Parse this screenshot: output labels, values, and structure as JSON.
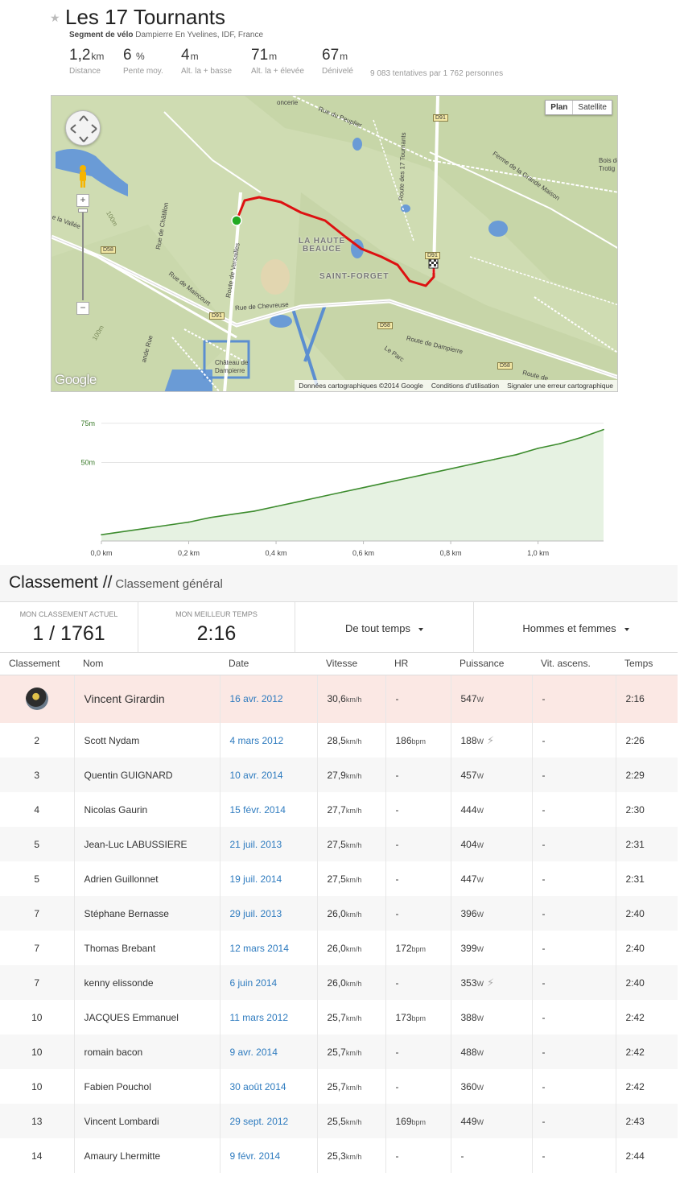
{
  "segment": {
    "title": "Les 17 Tournants",
    "subtitle_label": "Segment de vélo",
    "subtitle_location": "Dampierre En Yvelines, IDF, France",
    "stats": [
      {
        "value": "1,2",
        "unit": "km",
        "label": "Distance"
      },
      {
        "value": "6",
        "unit": "%",
        "label": "Pente moy."
      },
      {
        "value": "4",
        "unit": "m",
        "label": "Alt. la + basse"
      },
      {
        "value": "71",
        "unit": "m",
        "label": "Alt. la + élevée"
      },
      {
        "value": "67",
        "unit": "m",
        "label": "Dénivelé"
      }
    ],
    "attempts": "9 083 tentatives par 1 762 personnes"
  },
  "map": {
    "type_plan": "Plan",
    "type_satellite": "Satellite",
    "logo": "Google",
    "footer": [
      "Données cartographiques ©2014 Google",
      "Conditions d'utilisation",
      "Signaler une erreur cartographique"
    ],
    "labels": {
      "rue_peuplier": "Rue du Peuplier",
      "route_17": "Route des 17 Tournants",
      "ferme": "Ferme de la Grande Maison",
      "bois": "Bois de",
      "trotigny": "Trotig",
      "la_haute": "LA HAUTE",
      "beauce": "BEAUCE",
      "saint_forget": "SAINT-FORGET",
      "rue_chatillon": "Rue de Châtillon",
      "route_versailles": "Route de Versailles",
      "rue_maincourt": "Rue de Maincourt",
      "rue_chevreuse": "Rue de Chevreuse",
      "route_dampierre": "Route de Dampierre",
      "le_parc": "Le Parc",
      "route_de": "Route de",
      "chateau": "Château de",
      "dampierre": "Dampierre",
      "la_vallee": "e la Vallée",
      "conciere": "oncerie",
      "elev_100a": "100m",
      "elev_100b": "100m",
      "grande_rue": "ande Rue"
    },
    "shields": {
      "d91_a": "D91",
      "d91_b": "D91",
      "d91_c": "D91",
      "d58_a": "D58",
      "d58_b": "D58",
      "d58_c": "D58"
    },
    "route_color": "#dd1111",
    "start_marker_color": "#22aa22"
  },
  "chart_data": {
    "type": "area",
    "title": "",
    "xlabel": "",
    "ylabel": "",
    "x": [
      0.0,
      0.05,
      0.1,
      0.15,
      0.2,
      0.25,
      0.3,
      0.35,
      0.4,
      0.45,
      0.5,
      0.55,
      0.6,
      0.65,
      0.7,
      0.75,
      0.8,
      0.85,
      0.9,
      0.95,
      1.0,
      1.05,
      1.1,
      1.15
    ],
    "y": [
      4,
      6,
      8,
      10,
      12,
      15,
      17,
      19,
      22,
      25,
      28,
      31,
      34,
      37,
      40,
      43,
      46,
      49,
      52,
      55,
      59,
      62,
      66,
      71
    ],
    "xlim": [
      0,
      1.15
    ],
    "ylim": [
      0,
      80
    ],
    "xticks": [
      "0,0 km",
      "0,2 km",
      "0,4 km",
      "0,6 km",
      "0,8 km",
      "1,0 km"
    ],
    "xtick_values": [
      0,
      0.2,
      0.4,
      0.6,
      0.8,
      1.0
    ],
    "yticks": [
      "50m",
      "75m"
    ],
    "ytick_values": [
      50,
      75
    ],
    "line_color": "#3d8c2e",
    "fill_color": "#e6f2e2"
  },
  "leaderboard": {
    "title": "Classement",
    "separator": "//",
    "subtitle": "Classement général",
    "my_rank_label": "Mon classement actuel",
    "my_rank": "1 / 1761",
    "my_best_label": "Mon meilleur temps",
    "my_best": "2:16",
    "filter_time": "De tout temps",
    "filter_gender": "Hommes et femmes",
    "columns": [
      "Classement",
      "Nom",
      "Date",
      "Vitesse",
      "HR",
      "Puissance",
      "Vit. ascens.",
      "Temps"
    ],
    "rows": [
      {
        "rank": "",
        "name": "Vincent Girardin",
        "date": "16 avr. 2012",
        "speed": "30,6",
        "speed_unit": "km/h",
        "hr": "-",
        "hr_unit": "",
        "power": "547",
        "power_unit": "W",
        "bolt": false,
        "vam": "-",
        "time": "2:16",
        "me": true
      },
      {
        "rank": "2",
        "name": "Scott Nydam",
        "date": "4 mars 2012",
        "speed": "28,5",
        "speed_unit": "km/h",
        "hr": "186",
        "hr_unit": "bpm",
        "power": "188",
        "power_unit": "W",
        "bolt": true,
        "vam": "-",
        "time": "2:26"
      },
      {
        "rank": "3",
        "name": "Quentin GUIGNARD",
        "date": "10 avr. 2014",
        "speed": "27,9",
        "speed_unit": "km/h",
        "hr": "-",
        "hr_unit": "",
        "power": "457",
        "power_unit": "W",
        "bolt": false,
        "vam": "-",
        "time": "2:29"
      },
      {
        "rank": "4",
        "name": "Nicolas Gaurin",
        "date": "15 févr. 2014",
        "speed": "27,7",
        "speed_unit": "km/h",
        "hr": "-",
        "hr_unit": "",
        "power": "444",
        "power_unit": "W",
        "bolt": false,
        "vam": "-",
        "time": "2:30"
      },
      {
        "rank": "5",
        "name": "Jean-Luc LABUSSIERE",
        "date": "21 juil. 2013",
        "speed": "27,5",
        "speed_unit": "km/h",
        "hr": "-",
        "hr_unit": "",
        "power": "404",
        "power_unit": "W",
        "bolt": false,
        "vam": "-",
        "time": "2:31"
      },
      {
        "rank": "5",
        "name": "Adrien Guillonnet",
        "date": "19 juil. 2014",
        "speed": "27,5",
        "speed_unit": "km/h",
        "hr": "-",
        "hr_unit": "",
        "power": "447",
        "power_unit": "W",
        "bolt": false,
        "vam": "-",
        "time": "2:31"
      },
      {
        "rank": "7",
        "name": "Stéphane Bernasse",
        "date": "29 juil. 2013",
        "speed": "26,0",
        "speed_unit": "km/h",
        "hr": "-",
        "hr_unit": "",
        "power": "396",
        "power_unit": "W",
        "bolt": false,
        "vam": "-",
        "time": "2:40"
      },
      {
        "rank": "7",
        "name": "Thomas Brebant",
        "date": "12 mars 2014",
        "speed": "26,0",
        "speed_unit": "km/h",
        "hr": "172",
        "hr_unit": "bpm",
        "power": "399",
        "power_unit": "W",
        "bolt": false,
        "vam": "-",
        "time": "2:40"
      },
      {
        "rank": "7",
        "name": "kenny elissonde",
        "date": "6 juin 2014",
        "speed": "26,0",
        "speed_unit": "km/h",
        "hr": "-",
        "hr_unit": "",
        "power": "353",
        "power_unit": "W",
        "bolt": true,
        "vam": "-",
        "time": "2:40"
      },
      {
        "rank": "10",
        "name": "JACQUES Emmanuel",
        "date": "11 mars 2012",
        "speed": "25,7",
        "speed_unit": "km/h",
        "hr": "173",
        "hr_unit": "bpm",
        "power": "388",
        "power_unit": "W",
        "bolt": false,
        "vam": "-",
        "time": "2:42"
      },
      {
        "rank": "10",
        "name": "romain bacon",
        "date": "9 avr. 2014",
        "speed": "25,7",
        "speed_unit": "km/h",
        "hr": "-",
        "hr_unit": "",
        "power": "488",
        "power_unit": "W",
        "bolt": false,
        "vam": "-",
        "time": "2:42"
      },
      {
        "rank": "10",
        "name": "Fabien Pouchol",
        "date": "30 août 2014",
        "speed": "25,7",
        "speed_unit": "km/h",
        "hr": "-",
        "hr_unit": "",
        "power": "360",
        "power_unit": "W",
        "bolt": false,
        "vam": "-",
        "time": "2:42"
      },
      {
        "rank": "13",
        "name": "Vincent Lombardi",
        "date": "29 sept. 2012",
        "speed": "25,5",
        "speed_unit": "km/h",
        "hr": "169",
        "hr_unit": "bpm",
        "power": "449",
        "power_unit": "W",
        "bolt": false,
        "vam": "-",
        "time": "2:43"
      },
      {
        "rank": "14",
        "name": "Amaury Lhermitte",
        "date": "9 févr. 2014",
        "speed": "25,3",
        "speed_unit": "km/h",
        "hr": "-",
        "hr_unit": "",
        "power": "-",
        "power_unit": "",
        "bolt": false,
        "vam": "-",
        "time": "2:44"
      }
    ]
  }
}
